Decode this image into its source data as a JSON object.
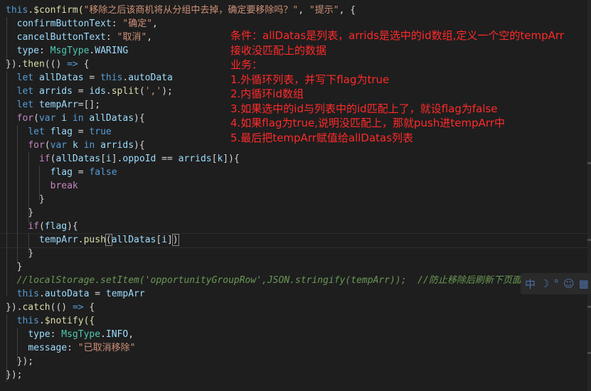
{
  "code": {
    "l1_a": "this",
    "l1_b": ".$confirm(",
    "l1_c": "\"移除之后该商机将从分组中去掉，确定要移除吗？\"",
    "l1_d": ", ",
    "l1_e": "\"提示\"",
    "l1_f": ", {",
    "l2_a": "confirmButtonText",
    "l2_b": ": ",
    "l2_c": "\"确定\"",
    "l2_d": ",",
    "l3_a": "cancelButtonText",
    "l3_b": ": ",
    "l3_c": "\"取消\"",
    "l3_d": ",",
    "l4_a": "type",
    "l4_b": ": ",
    "l4_c": "MsgType",
    "l4_d": ".",
    "l4_e": "WARING",
    "l5_a": "}).",
    "l5_b": "then",
    "l5_c": "(() ",
    "l5_d": "=>",
    "l5_e": " {",
    "l6_a": "let ",
    "l6_b": "allDatas",
    "l6_c": " = ",
    "l6_d": "this",
    "l6_e": ".",
    "l6_f": "autoData",
    "l7_a": "let ",
    "l7_b": "arrids",
    "l7_c": " = ",
    "l7_d": "ids",
    "l7_e": ".",
    "l7_f": "split",
    "l7_g": "(",
    "l7_h": "','",
    "l7_i": ");",
    "l8_a": "let ",
    "l8_b": "tempArr",
    "l8_c": "=[];",
    "l9_a": "for",
    "l9_b": "(",
    "l9_c": "var ",
    "l9_d": "i",
    "l9_e": " in ",
    "l9_f": "allDatas",
    "l9_g": "){",
    "l10_a": "let ",
    "l10_b": "flag",
    "l10_c": " = ",
    "l10_d": "true",
    "l11_a": "for",
    "l11_b": "(",
    "l11_c": "var ",
    "l11_d": "k",
    "l11_e": " in ",
    "l11_f": "arrids",
    "l11_g": "){",
    "l12_a": "if",
    "l12_b": "(",
    "l12_c": "allDatas",
    "l12_d": "[",
    "l12_e": "i",
    "l12_f": "].",
    "l12_g": "oppoId",
    "l12_h": " == ",
    "l12_i": "arrids",
    "l12_j": "[",
    "l12_k": "k",
    "l12_l": "]){",
    "l13_a": "flag",
    "l13_b": " = ",
    "l13_c": "false",
    "l14_a": "break",
    "l15_a": "}",
    "l16_a": "}",
    "l17_a": "if",
    "l17_b": "(",
    "l17_c": "flag",
    "l17_d": "){",
    "l18_a": "tempArr",
    "l18_b": ".",
    "l18_c": "push",
    "l18_d": "(",
    "l18_e": "allDatas",
    "l18_f": "[",
    "l18_g": "i",
    "l18_h": "]",
    "l18_i": ")",
    "l19_a": "}",
    "l20_a": "}",
    "l21_a": "//localStorage.setItem('opportunityGroupRow',JSON.stringify(tempArr));  //防止移除后刷新下页面",
    "l22_a": "this",
    "l22_b": ".",
    "l22_c": "autoData",
    "l22_d": " = ",
    "l22_e": "tempArr",
    "l23_a": "}).",
    "l23_b": "catch",
    "l23_c": "(() ",
    "l23_d": "=>",
    "l23_e": " {",
    "l24_a": "this",
    "l24_b": ".$notify({",
    "l25_a": "type",
    "l25_b": ": ",
    "l25_c": "MsgType",
    "l25_d": ".",
    "l25_e": "INFO",
    "l25_f": ",",
    "l26_a": "message",
    "l26_b": ": ",
    "l26_c": "\"已取消移除\"",
    "l27_a": "});",
    "l28_a": "});"
  },
  "notes": {
    "n1": "条件：allDatas是列表，arrids是选中的id数组,定义一个空的tempArr",
    "n2": "接收没匹配上的数据",
    "n3": "业务：",
    "n4": "1.外循环列表，并写下flag为true",
    "n5": "2.内循环id数组",
    "n6": "3.如果选中的id与列表中的id匹配上了，就设flag为false",
    "n7": "4.如果flag为true,说明没匹配上，那就push进tempArr中",
    "n8": "5.最后把tempArr赋值给allDatas列表"
  },
  "ime": {
    "lang": "中",
    "moon": "☽",
    "dot": "°",
    "emoji": "☺",
    "grid": "▦"
  },
  "colors": {
    "background": "#1e1e1e",
    "keyword": "#569cd6",
    "control": "#c586c0",
    "function": "#dcdcaa",
    "variable": "#9cdcfe",
    "string": "#ce9178",
    "class": "#4ec9b0",
    "comment": "#6a9955",
    "note": "#ff2a2a"
  }
}
